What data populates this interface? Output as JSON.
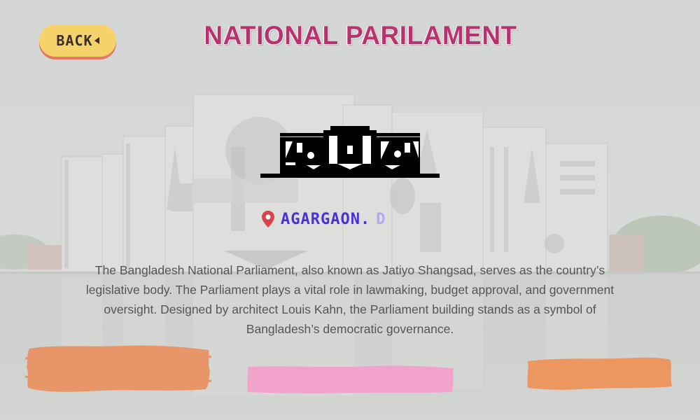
{
  "header": {
    "title": "NATIONAL PARILAMENT",
    "back_label": "BACK"
  },
  "location": {
    "label": "AGARGAON.",
    "cursor_char": "D",
    "pin_icon": "map-pin-icon",
    "pin_color": "#d9434f"
  },
  "description": "The Bangladesh National Parliament, also known as Jatiyo Shangsad, serves as the country’s legislative body. The Parliament plays a vital role in lawmaking, budget approval, and government oversight. Designed by architect Louis Kahn, the Parliament building stands as a symbol of Bangladesh’s democratic governance.",
  "icons": {
    "parliament": "parliament-building-icon",
    "back": "caret-left-icon"
  },
  "colors": {
    "title": "#b8326d",
    "back_button": "#f5d36a",
    "location_text": "#4b2fd8",
    "brush_left": "#e8956a",
    "brush_center": "#f2a3cc",
    "brush_right": "#ec9660"
  }
}
